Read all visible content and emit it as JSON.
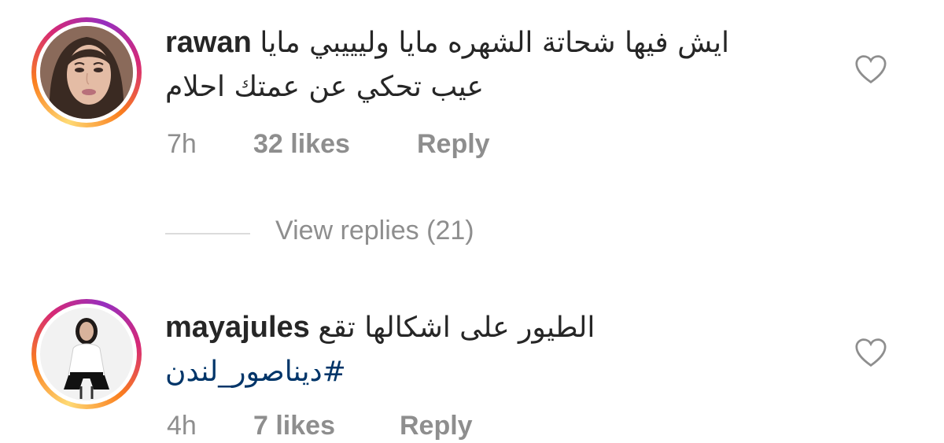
{
  "comments": [
    {
      "username": "rawan",
      "text_line1": "ايش فيها شحاتة الشهره مايا وليييبي مايا",
      "text_line2": "عيب تحكي عن عمتك احلام",
      "time": "7h",
      "likes": "32 likes",
      "reply_label": "Reply",
      "avatar": "woman-portrait-closeup",
      "heart_icon": "heart-outline-icon"
    },
    {
      "username": "mayajules",
      "text_line1": "الطيور على اشكالها تقع",
      "hashtag": "#ديناصور_لندن",
      "time": "4h",
      "likes": "7 likes",
      "reply_label": "Reply",
      "avatar": "woman-full-body-white-shirt",
      "heart_icon": "heart-outline-icon"
    }
  ],
  "view_replies": {
    "label": "View replies (21)"
  },
  "colors": {
    "text": "#262626",
    "meta": "#8e8e8e",
    "hashtag": "#003569",
    "divider": "#dbdbdb"
  }
}
